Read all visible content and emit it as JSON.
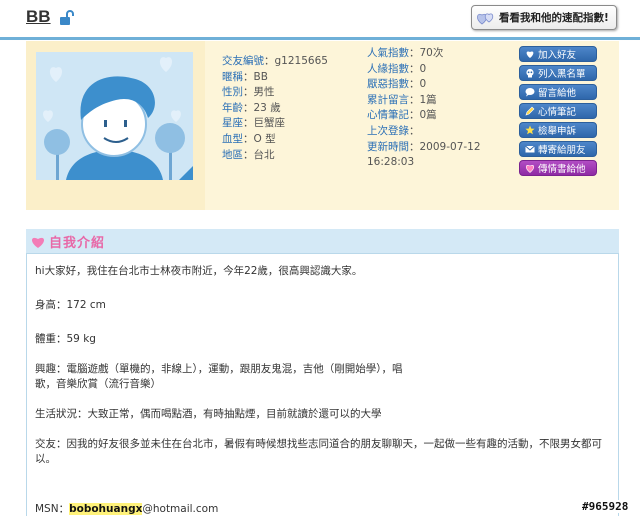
{
  "header": {
    "nickname": "BB",
    "lock_icon": "lock-icon",
    "match_button_label": "看看我和他的速配指數!"
  },
  "profile": {
    "info": [
      {
        "key": "交友編號",
        "value": "g1215665"
      },
      {
        "key": "暱稱",
        "value": "BB"
      },
      {
        "key": "性別",
        "value": "男性"
      },
      {
        "key": "年齡",
        "value": "23 歲"
      },
      {
        "key": "星座",
        "value": "巨蟹座"
      },
      {
        "key": "血型",
        "value": "O 型"
      },
      {
        "key": "地區",
        "value": "台北"
      }
    ],
    "stats": [
      {
        "key": "人氣指數",
        "value": "70次"
      },
      {
        "key": "人緣指數",
        "value": "0"
      },
      {
        "key": "厭惡指數",
        "value": "0"
      },
      {
        "key": "累計留言",
        "value": "1篇"
      },
      {
        "key": "心情筆記",
        "value": "0篇"
      },
      {
        "key": "上次登錄",
        "value": ""
      },
      {
        "key": "更新時間",
        "value": "2009-07-12"
      }
    ],
    "update_time_2": "16:28:03",
    "actions": [
      {
        "label": "加入好友",
        "icon": "heart-icon",
        "color": "blue"
      },
      {
        "label": "列入黑名單",
        "icon": "skull-icon",
        "color": "blue"
      },
      {
        "label": "留言給他",
        "icon": "chat-icon",
        "color": "blue"
      },
      {
        "label": "心情筆記",
        "icon": "pencil-icon",
        "color": "blue"
      },
      {
        "label": "檢舉申訴",
        "icon": "star-icon",
        "color": "blue"
      },
      {
        "label": "轉寄給朋友",
        "icon": "mail-icon",
        "color": "blue"
      },
      {
        "label": "傳情書給他",
        "icon": "love-letter-icon",
        "color": "purple"
      }
    ]
  },
  "intro": {
    "title": "自我介紹",
    "p1": "hi大家好，我住在台北市士林夜市附近，今年22歲，很高興認識大家。",
    "p2": "身高：172 cm",
    "p3": "體重：59 kg",
    "p4": "興趣：電腦遊戲（單機的，非線上），運動，跟朋友鬼混，吉他（剛開始學），唱歌，音樂欣賞（流行音樂）",
    "p5": "生活狀況：大致正常，偶而喝點酒，有時抽點煙，目前就讀於還可以的大學",
    "p6": "交友：因我的好友很多並未住在台北市，暑假有時候想找些志同道合的朋友聊聊天，一起做一些有趣的活動，不限男女都可以。",
    "msn_prefix": "MSN：",
    "msn_user": "bobohuangx",
    "msn_domain": "@hotmail.com"
  },
  "watermark": "#965928",
  "colors": {
    "accent_blue": "#2a6fb6",
    "profile_bg": "#fdf5d9",
    "intro_header_bg": "#d4e9f6",
    "title_pink": "#e868a7",
    "button_blue": "#3a74b8",
    "button_purple": "#9b35b0"
  }
}
